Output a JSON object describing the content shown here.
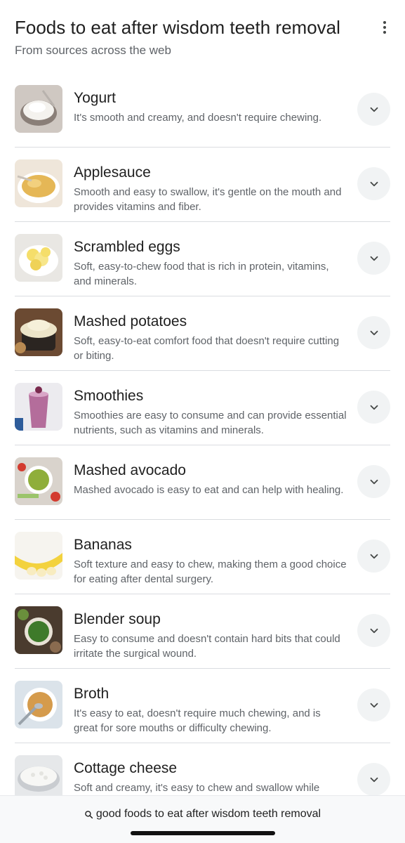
{
  "header": {
    "title": "Foods to eat after wisdom teeth removal",
    "subtitle": "From sources across the web",
    "menu_icon": "more-vert-icon"
  },
  "items": [
    {
      "name": "Yogurt",
      "description": "It's smooth and creamy, and doesn't require chewing.",
      "thumb_color": "#d9d4cf"
    },
    {
      "name": "Applesauce",
      "description": "Smooth and easy to swallow, it's gentle on the mouth and provides vitamins and fiber.",
      "thumb_color": "#e8c67a"
    },
    {
      "name": "Scrambled eggs",
      "description": "Soft, easy-to-chew food that is rich in protein, vitamins, and minerals.",
      "thumb_color": "#f3e27c"
    },
    {
      "name": "Mashed potatoes",
      "description": "Soft, easy-to-eat comfort food that doesn't require cutting or biting.",
      "thumb_color": "#e9e2c9"
    },
    {
      "name": "Smoothies",
      "description": "Smoothies are easy to consume and can provide essential nutrients, such as vitamins and minerals.",
      "thumb_color": "#b9739f"
    },
    {
      "name": "Mashed avocado",
      "description": "Mashed avocado is easy to eat and can help with healing.",
      "thumb_color": "#8cab3d"
    },
    {
      "name": "Bananas",
      "description": "Soft texture and easy to chew, making them a good choice for eating after dental surgery.",
      "thumb_color": "#f6d64a"
    },
    {
      "name": "Blender soup",
      "description": "Easy to consume and doesn't contain hard bits that could irritate the surgical wound.",
      "thumb_color": "#3f6b2f"
    },
    {
      "name": "Broth",
      "description": "It's easy to eat, doesn't require much chewing, and is great for sore mouths or difficulty chewing.",
      "thumb_color": "#d8a55a"
    },
    {
      "name": "Cottage cheese",
      "description": "Soft and creamy, it's easy to chew and swallow while recovering from wisdom teeth surgery.",
      "thumb_color": "#eeeeee"
    }
  ],
  "expand_icon": "chevron-down-icon",
  "bottom_bar": {
    "search_icon": "search-icon",
    "query": "good foods to eat after wisdom teeth removal"
  }
}
